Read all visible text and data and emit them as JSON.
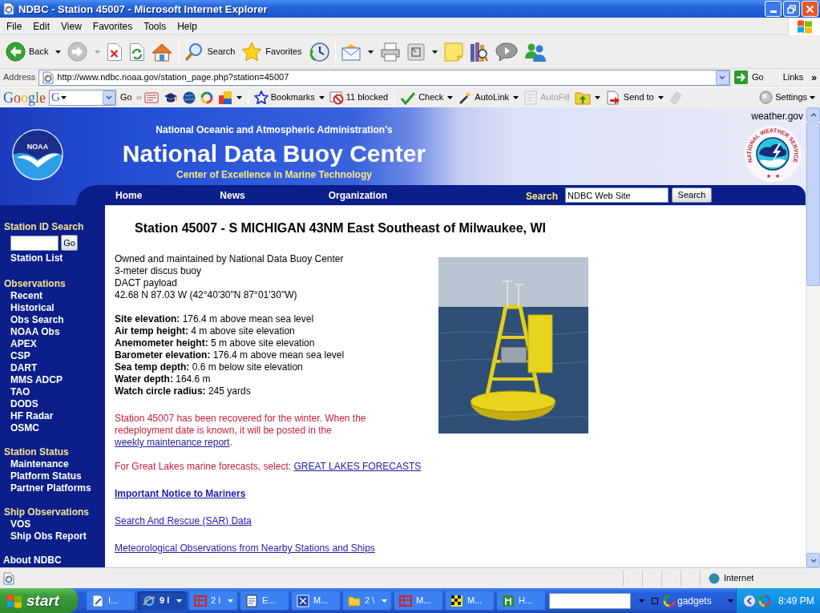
{
  "window": {
    "title": "NDBC - Station 45007 - Microsoft Internet Explorer"
  },
  "menu_bar": [
    {
      "label": "File"
    },
    {
      "label": "Edit"
    },
    {
      "label": "View"
    },
    {
      "label": "Favorites"
    },
    {
      "label": "Tools"
    },
    {
      "label": "Help"
    }
  ],
  "toolbar": {
    "groups": [
      [
        {
          "kind": "back",
          "label": "Back",
          "dropdown": true,
          "disabled": false
        },
        {
          "kind": "forward",
          "dropdown": true,
          "disabled": true
        },
        {
          "kind": "stop",
          "dropdown": false,
          "disabled": false
        },
        {
          "kind": "refresh",
          "dropdown": false,
          "disabled": false
        },
        {
          "kind": "home",
          "dropdown": false,
          "disabled": false
        }
      ],
      [
        {
          "kind": "search",
          "label": "Search",
          "dropdown": false,
          "disabled": false
        },
        {
          "kind": "favorites",
          "label": "Favorites",
          "dropdown": false,
          "disabled": false
        },
        {
          "kind": "history",
          "dropdown": false,
          "disabled": false
        }
      ],
      [
        {
          "kind": "mail",
          "dropdown": true,
          "disabled": false
        },
        {
          "kind": "print",
          "dropdown": false,
          "disabled": false
        },
        {
          "kind": "edit",
          "dropdown": true,
          "disabled": false
        },
        {
          "kind": "notes",
          "dropdown": false,
          "disabled": false
        },
        {
          "kind": "research",
          "dropdown": false,
          "disabled": false
        },
        {
          "kind": "chat",
          "dropdown": false,
          "disabled": false
        },
        {
          "kind": "contacts",
          "dropdown": false,
          "disabled": false
        }
      ]
    ]
  },
  "address_bar": {
    "label": "Address",
    "url": "http://www.ndbc.noaa.gov/station_page.php?station=45007",
    "go": "Go",
    "links": "Links",
    "chevron": "»"
  },
  "google_bar": {
    "logo": "Google",
    "engine": "G",
    "go": "Go",
    "groups": [
      [
        {
          "kind": "news",
          "dropdown": false,
          "disabled": false
        },
        {
          "kind": "cap",
          "dropdown": false,
          "disabled": false
        },
        {
          "kind": "globe",
          "dropdown": false,
          "disabled": false
        },
        {
          "kind": "swirl",
          "dropdown": false,
          "disabled": false
        },
        {
          "kind": "blocks",
          "dropdown": true,
          "disabled": false
        }
      ],
      [
        {
          "kind": "bookmarks",
          "label": "Bookmarks",
          "dropdown": true,
          "disabled": false
        },
        {
          "kind": "blocker",
          "label": "11 blocked",
          "dropdown": false,
          "disabled": false
        }
      ],
      [
        {
          "kind": "spell",
          "label": "Check",
          "dropdown": true,
          "disabled": false
        },
        {
          "kind": "autolink",
          "label": "AutoLink",
          "dropdown": true,
          "disabled": false
        },
        {
          "kind": "autofill",
          "label": "AutoFill",
          "dropdown": false,
          "disabled": true
        },
        {
          "kind": "upload",
          "dropdown": true,
          "disabled": false
        },
        {
          "kind": "sendto",
          "label": "Send to",
          "dropdown": true,
          "disabled": false
        },
        {
          "kind": "eraser",
          "dropdown": false,
          "disabled": true
        }
      ]
    ],
    "settings": "Settings"
  },
  "banner": {
    "noaa_logo": "NOAA",
    "agency": "National Oceanic and Atmospheric Administration's",
    "title": "National Data Buoy Center",
    "tagline": "Center of Excellence in Marine Technology",
    "weather_link": "weather.gov",
    "nws_logo": "NATIONAL WEATHER SERVICE"
  },
  "nav": {
    "links": [
      {
        "label": "Home"
      },
      {
        "label": "News"
      },
      {
        "label": "Organization"
      }
    ],
    "search_label": "Search",
    "search_value": "NDBC Web Site",
    "search_button": "Search"
  },
  "sidebar": {
    "sections": [
      {
        "kind": "search",
        "heading": "Station ID Search",
        "button": "Go",
        "items": [
          {
            "label": "Station List"
          }
        ]
      },
      {
        "kind": "menu",
        "heading": "Observations",
        "items": [
          {
            "label": "Recent"
          },
          {
            "label": "Historical"
          },
          {
            "label": "Obs Search"
          },
          {
            "label": "NOAA Obs"
          },
          {
            "label": "APEX"
          },
          {
            "label": "CSP"
          },
          {
            "label": "DART"
          },
          {
            "label": "MMS ADCP"
          },
          {
            "label": "TAO"
          },
          {
            "label": "DODS"
          },
          {
            "label": "HF Radar"
          },
          {
            "label": "OSMC"
          }
        ]
      },
      {
        "kind": "menu",
        "heading": "Station Status",
        "items": [
          {
            "label": "Maintenance"
          },
          {
            "label": "Platform Status"
          },
          {
            "label": "Partner Platforms"
          }
        ]
      },
      {
        "kind": "menu",
        "heading": "Ship Observations",
        "items": [
          {
            "label": "VOS"
          },
          {
            "label": "Ship Obs Report"
          }
        ]
      },
      {
        "kind": "link",
        "heading": "About NDBC"
      }
    ]
  },
  "station": {
    "title": "Station 45007 - S MICHIGAN 43NM East Southeast of Milwaukee, WI",
    "description": [
      "Owned and maintained by National Data Buoy Center",
      "3-meter discus buoy",
      "DACT payload",
      "42.68 N 87.03 W (42°40'30\"N 87°01'30\"W)"
    ],
    "specs": [
      "**Site elevation:** 176.4 m above mean sea level",
      "**Air temp height:** 4 m above site elevation",
      "**Anemometer height:** 5 m above site elevation",
      "**Barometer elevation:** 176.4 m above mean sea level",
      "**Sea temp depth:** 0.6 m below site elevation",
      "**Water depth:** 164.6 m",
      "**Watch circle radius:** 245 yards"
    ],
    "notice": {
      "text": "Station 45007 has been recovered for the winter. When the redeployment date is known, it will be posted in the ",
      "link": "weekly maintenance report",
      "end": "."
    },
    "forecast": {
      "text": "For Great Lakes marine forecasts, select: ",
      "link": "GREAT LAKES FORECASTS"
    },
    "links": [
      {
        "label": "Important Notice to Mariners",
        "bold": true
      },
      {
        "label": "Search And Rescue (SAR) Data",
        "bold": false
      },
      {
        "label": "Meteorological Observations from Nearby Stations and Ships",
        "bold": false
      }
    ]
  },
  "status_bar": {
    "zone": "Internet"
  },
  "taskbar": {
    "start": "start",
    "tasks": [
      {
        "kind": "writer",
        "label": "I...",
        "selected": false,
        "grouped": false
      },
      {
        "kind": "browser",
        "label": "9 I",
        "selected": true,
        "grouped": true
      },
      {
        "kind": "slides",
        "label": "2 I",
        "selected": false,
        "grouped": true
      },
      {
        "kind": "document",
        "label": "E...",
        "selected": false,
        "grouped": false
      },
      {
        "kind": "viewer",
        "label": "M...",
        "selected": false,
        "grouped": false
      },
      {
        "kind": "folder",
        "label": "2 \\",
        "selected": false,
        "grouped": true
      },
      {
        "kind": "slides",
        "label": "M...",
        "selected": false,
        "grouped": false
      },
      {
        "kind": "media",
        "label": "M...",
        "selected": false,
        "grouped": false
      },
      {
        "kind": "antenna",
        "label": "H...",
        "selected": false,
        "grouped": false
      }
    ],
    "gadgets": "gadgets",
    "clock": "8:49 PM"
  }
}
